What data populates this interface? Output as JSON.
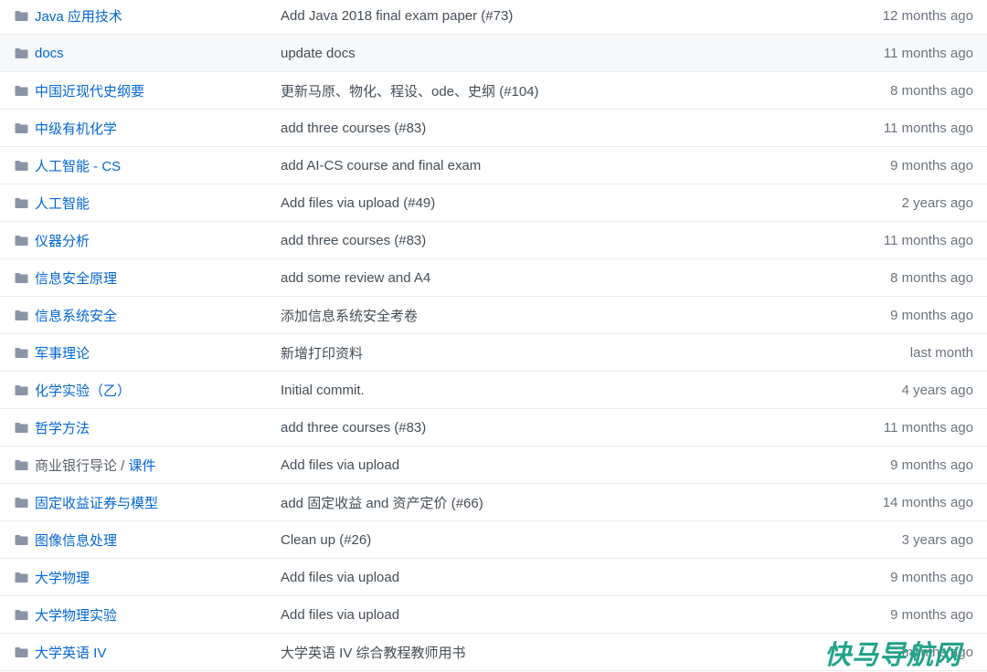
{
  "watermark": "快马导航网",
  "rows": [
    {
      "name": "Java 应用技术",
      "message": "Add Java 2018 final exam paper (#73)",
      "age": "12 months ago"
    },
    {
      "name": "docs",
      "message": "update docs",
      "age": "11 months ago"
    },
    {
      "name": "中国近现代史纲要",
      "message": "更新马原、物化、程设、ode、史纲 (#104)",
      "age": "8 months ago"
    },
    {
      "name": "中级有机化学",
      "message": "add three courses (#83)",
      "age": "11 months ago"
    },
    {
      "name": "人工智能 - CS",
      "message": "add AI-CS course and final exam",
      "age": "9 months ago"
    },
    {
      "name": "人工智能",
      "message": "Add files via upload (#49)",
      "age": "2 years ago"
    },
    {
      "name": "仪器分析",
      "message": "add three courses (#83)",
      "age": "11 months ago"
    },
    {
      "name": "信息安全原理",
      "message": "add some review and A4",
      "age": "8 months ago"
    },
    {
      "name": "信息系统安全",
      "message": "添加信息系统安全考卷",
      "age": "9 months ago"
    },
    {
      "name": "军事理论",
      "message": "新增打印资料",
      "age": "last month"
    },
    {
      "name": "化学实验（乙）",
      "message": "Initial commit.",
      "age": "4 years ago"
    },
    {
      "name": "哲学方法",
      "message": "add three courses (#83)",
      "age": "11 months ago"
    },
    {
      "name_prefix": "商业银行导论 / ",
      "name": "课件",
      "message": "Add files via upload",
      "age": "9 months ago"
    },
    {
      "name": "固定收益证券与模型",
      "message": "add 固定收益 and 资产定价 (#66)",
      "age": "14 months ago"
    },
    {
      "name": "图像信息处理",
      "message": "Clean up (#26)",
      "age": "3 years ago"
    },
    {
      "name": "大学物理",
      "message": "Add files via upload",
      "age": "9 months ago"
    },
    {
      "name": "大学物理实验",
      "message": "Add files via upload",
      "age": "9 months ago"
    },
    {
      "name": "大学英语 IV",
      "message": "大学英语 IV 综合教程教师用书",
      "age": "months ago"
    }
  ]
}
